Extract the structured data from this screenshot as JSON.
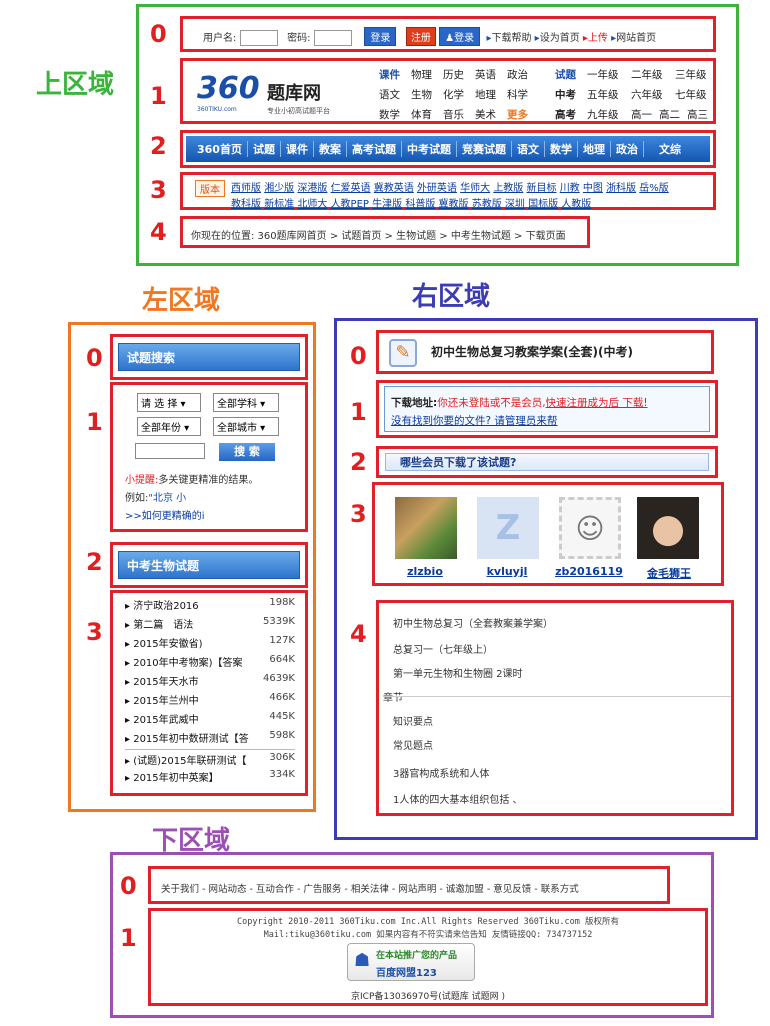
{
  "regions": {
    "top": "上区域",
    "left": "左区域",
    "right": "右区域",
    "bottom": "下区域"
  },
  "nums": [
    "0",
    "1",
    "2",
    "3",
    "4"
  ],
  "topbar": {
    "user_label": "用户名:",
    "pass_label": "密码:",
    "login": "登录",
    "register": "注册",
    "qq_login": "登录",
    "links": [
      "下载帮助",
      "设为首页",
      "上传",
      "网站首页"
    ]
  },
  "logo": {
    "main": "360",
    "title": "题库网",
    "domain": "360TIKU.com",
    "slogan": "专业小初高试题平台"
  },
  "cats": {
    "left": [
      [
        "课件",
        "物理",
        "历史",
        "英语",
        "政治"
      ],
      [
        "语文",
        "生物",
        "化学",
        "地理",
        "科学"
      ],
      [
        "数学",
        "体育",
        "音乐",
        "美术",
        "更多"
      ]
    ],
    "right": [
      [
        "试题",
        "一年级",
        "二年级",
        "三年级"
      ],
      [
        "中考",
        "五年级",
        "六年级",
        "七年级"
      ],
      [
        "高考",
        "九年级",
        "高一",
        "高二",
        "高三"
      ]
    ]
  },
  "nav": [
    "360首页",
    "试题",
    "课件",
    "教案",
    "高考试题",
    "中考试题",
    "竞赛试题",
    "语文",
    "数学",
    "地理",
    "政治",
    "文综"
  ],
  "versions": {
    "label": "版本",
    "row1": [
      "西师版",
      "湘少版",
      "深港版",
      "仁爱英语",
      "冀教英语",
      "外研英语",
      "华师大",
      "上教版",
      "新目标",
      "川教",
      "中图",
      "浙科版",
      "岳%版"
    ],
    "row2": [
      "教科版",
      "新标准",
      "北师大",
      "人教PEP",
      "牛津版",
      "科普版",
      "冀教版",
      "苏教版",
      "深圳",
      "国标版",
      "人教版"
    ]
  },
  "breadcrumb": "你现在的位置: 360题库网首页 > 试题首页 > 生物试题 > 中考生物试题 > 下载页面",
  "left": {
    "search_title": "试题搜索",
    "sel1": "请 选 择",
    "sel2": "全部学科",
    "sel3": "全部年份",
    "sel4": "全部城市",
    "search_btn": "搜 索",
    "tip_label": "小提醒:",
    "tip": "多关键更精准的结果。",
    "example_label": "例如:",
    "example": "\"北京 小",
    "howto": ">>如何更精确的i",
    "list_title": "中考生物试题",
    "items": [
      [
        "济宁政治2016",
        "198K"
      ],
      [
        "第二篇　语法",
        "5339K"
      ],
      [
        "2015年安徽省)",
        "127K"
      ],
      [
        "2010年中考物案)【答案",
        "664K"
      ],
      [
        "2015年天水市",
        "4639K"
      ],
      [
        "2015年兰州中",
        "466K"
      ],
      [
        "2015年武威中",
        "445K"
      ],
      [
        "2015年初中数研测试【答",
        "598K"
      ],
      [
        "(试题)2015年联研测试【",
        "306K"
      ],
      [
        "2015年初中英案】",
        "334K"
      ]
    ]
  },
  "right": {
    "title": "初中生物总复习教案学案(全套)(中考)",
    "dl_label": "下载地址:",
    "dl_msg": "你还未登陆或不是会员,",
    "dl_link": "快速注册成为后 下载!",
    "notfound": "没有找到你要的文件? 请管理员来帮",
    "who": "哪些会员下载了该试题?",
    "users": [
      "zlzbio",
      "kvluyjl",
      "zb2016119",
      "金毛狮王"
    ],
    "outline": [
      "初中生物总复习（全套教案兼学案）",
      "总复习一（七年级上）",
      "第一单元生物和生物圈 2课时",
      "章节",
      "知识要点",
      "常见题点",
      "3器官构成系统和人体",
      "1人体的四大基本组织包括 、"
    ]
  },
  "footer": {
    "links": "关于我们 - 网站动态 - 互动合作 - 广告服务 - 相关法律 - 网站声明 - 诚邀加盟 - 意见反馈 - 联系方式",
    "copy": "Copyright 2010-2011 360Tiku.com Inc.All Rights Reserved 360Tiku.com 版权所有",
    "mail": "Mail:tiku@360tiku.com 如果内容有不符实请来信告知 友情链接QQ: 734737152",
    "badge1": "在本站推广您的产品",
    "badge2": "百度网盟123",
    "icp": "京ICP备13036970号(试题库 试题网 )"
  },
  "colors": {
    "top": "#3cb43c",
    "left": "#f07820",
    "right": "#3c3cb4",
    "bottom": "#9c50b4",
    "accent": "#e0202a"
  }
}
